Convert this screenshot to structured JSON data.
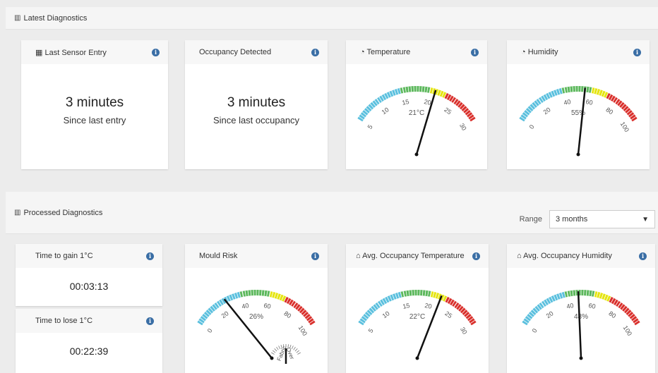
{
  "latest": {
    "title": "Latest Diagnostics",
    "cards": {
      "last_sensor": {
        "title": "Last Sensor Entry",
        "value": "3 minutes",
        "sub": "Since last entry"
      },
      "occupancy": {
        "title": "Occupancy Detected",
        "value": "3 minutes",
        "sub": "Since last occupancy"
      },
      "temperature": {
        "title": "Temperature",
        "ticks": [
          "5",
          "10",
          "15",
          "20",
          "25",
          "30"
        ],
        "min": 5,
        "max": 30,
        "value": 21,
        "readout": "21°C"
      },
      "humidity": {
        "title": "Humidity",
        "ticks": [
          "0",
          "20",
          "40",
          "60",
          "80",
          "100"
        ],
        "min": 0,
        "max": 100,
        "value": 55,
        "readout": "55%"
      }
    }
  },
  "processed": {
    "title": "Processed Diagnostics",
    "range_label": "Range",
    "range_value": "3 months",
    "gain": {
      "title": "Time to gain 1°C",
      "value": "00:03:13"
    },
    "lose": {
      "title": "Time to lose 1°C",
      "value": "00:22:39"
    },
    "mould": {
      "title": "Mould Risk",
      "ticks": [
        "0",
        "20",
        "40",
        "60",
        "80",
        "100"
      ],
      "min": 0,
      "max": 100,
      "value": 26,
      "readout": "26%",
      "sub_labels": [
        "Fabric",
        "Over"
      ]
    },
    "avg_temp": {
      "title": "Avg. Occupancy Temperature",
      "ticks": [
        "5",
        "10",
        "15",
        "20",
        "25",
        "30"
      ],
      "min": 5,
      "max": 30,
      "value": 22,
      "readout": "22°C"
    },
    "avg_hum": {
      "title": "Avg. Occupancy Humidity",
      "ticks": [
        "0",
        "20",
        "40",
        "60",
        "80",
        "100"
      ],
      "min": 0,
      "max": 100,
      "value": 48,
      "readout": "48%"
    }
  },
  "colors": {
    "blue": "#5bc0de",
    "green": "#5cb85c",
    "yellow": "#e5e510",
    "red": "#d9302c",
    "info": "#3a6ea5"
  },
  "icons": {
    "chart": "bar-chart-icon",
    "calendar": "calendar-icon",
    "dashboard": "dashboard-icon",
    "home": "home-icon",
    "info": "info-icon",
    "chevron": "chevron-down-icon"
  }
}
